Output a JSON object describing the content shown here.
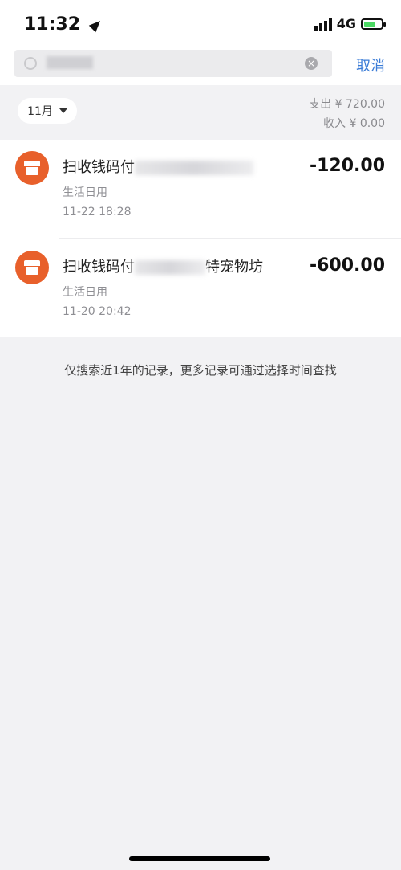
{
  "status_bar": {
    "time": "11:32",
    "network": "4G"
  },
  "search": {
    "placeholder": "",
    "cancel_label": "取消"
  },
  "filter": {
    "month_label": "11月"
  },
  "summary": {
    "expense_text": "支出 ¥ 720.00",
    "income_text": "收入 ¥ 0.00"
  },
  "transactions": [
    {
      "title": "扫收钱码付",
      "category": "生活日用",
      "datetime": "11-22  18:28",
      "amount": "-120.00"
    },
    {
      "title": "扫收钱码付",
      "title_suffix": "特宠物坊",
      "category": "生活日用",
      "datetime": "11-20  20:42",
      "amount": "-600.00"
    }
  ],
  "footer_note": "仅搜索近1年的记录，更多记录可通过选择时间查找",
  "colors": {
    "accent": "#3b7cd7",
    "shop_icon": "#e8602b",
    "background": "#f2f2f4"
  },
  "icons": [
    "location-arrow-icon",
    "signal-icon",
    "battery-icon",
    "search-icon",
    "clear-icon",
    "caret-down-icon",
    "shop-icon"
  ]
}
